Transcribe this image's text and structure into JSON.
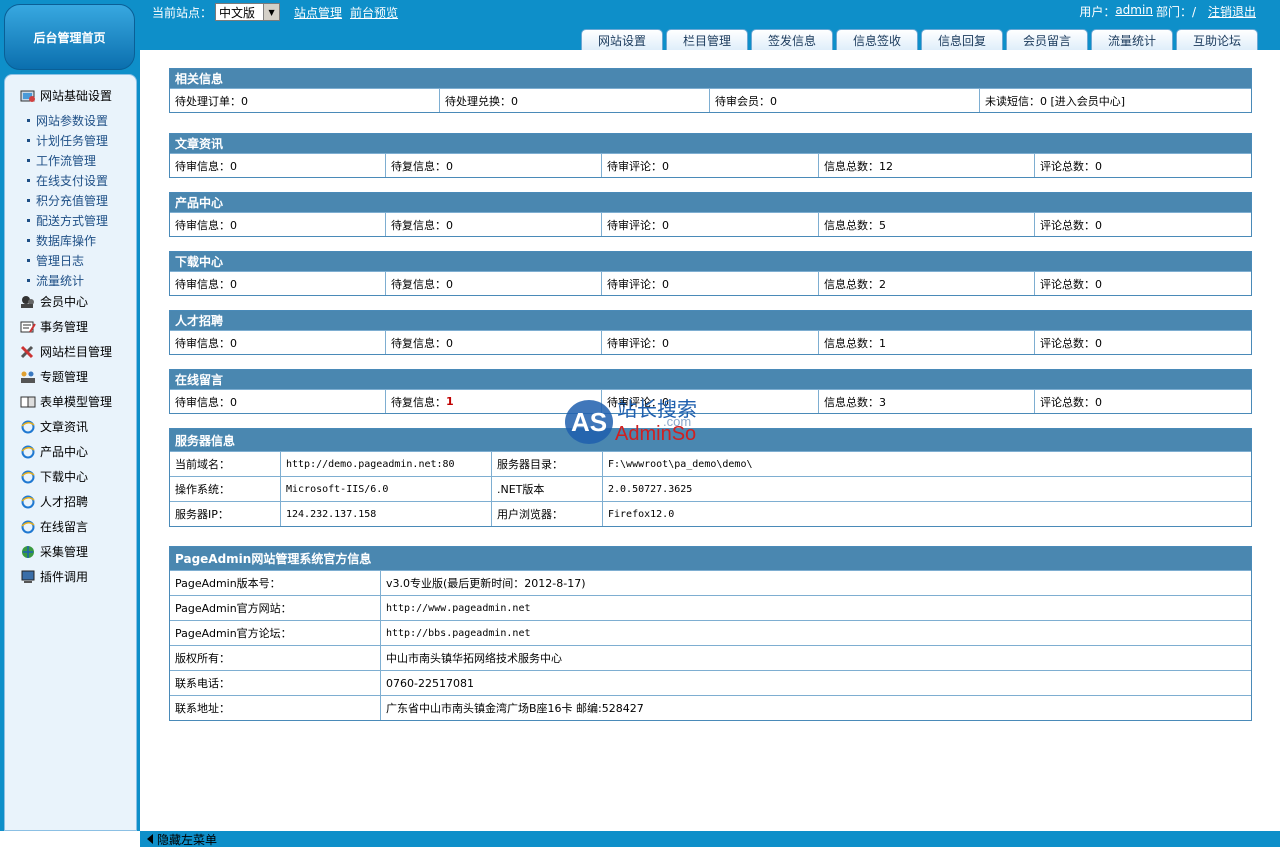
{
  "header": {
    "logo_text": "后台管理首页",
    "current_site_label": "当前站点：",
    "current_site_value": "中文版",
    "site_manage_link": "站点管理",
    "front_preview_link": "前台预览",
    "user_label": "用户：",
    "user_name": "admin",
    "dept_label": "部门：/",
    "logout_link": "注销退出"
  },
  "tabs": [
    "网站设置",
    "栏目管理",
    "签发信息",
    "信息签收",
    "信息回复",
    "会员留言",
    "流量统计",
    "互助论坛"
  ],
  "sidebar": {
    "basic_settings": "网站基础设置",
    "sub_items": [
      "网站参数设置",
      "计划任务管理",
      "工作流管理",
      "在线支付设置",
      "积分充值管理",
      "配送方式管理",
      "数据库操作",
      "管理日志",
      "流量统计"
    ],
    "groups": [
      {
        "label": "会员中心",
        "icon": "members-icon"
      },
      {
        "label": "事务管理",
        "icon": "tasks-icon"
      },
      {
        "label": "网站栏目管理",
        "icon": "tools-icon"
      },
      {
        "label": "专题管理",
        "icon": "topics-icon"
      },
      {
        "label": "表单模型管理",
        "icon": "form-model-icon"
      },
      {
        "label": "文章资讯",
        "icon": "ie-icon"
      },
      {
        "label": "产品中心",
        "icon": "ie-icon"
      },
      {
        "label": "下载中心",
        "icon": "ie-icon"
      },
      {
        "label": "人才招聘",
        "icon": "ie-icon"
      },
      {
        "label": "在线留言",
        "icon": "ie-icon"
      },
      {
        "label": "采集管理",
        "icon": "globe-icon"
      },
      {
        "label": "插件调用",
        "icon": "computer-icon"
      }
    ]
  },
  "related": {
    "title": "相关信息",
    "cells": [
      "待处理订单：0",
      "待处理兑换：0",
      "待审会员：0",
      "未读短信：0 [进入会员中心]"
    ]
  },
  "sections": [
    {
      "title": "文章资讯",
      "cells": [
        "待审信息：0",
        "待复信息：0",
        "待审评论：0",
        "信息总数：12",
        "评论总数：0"
      ]
    },
    {
      "title": "产品中心",
      "cells": [
        "待审信息：0",
        "待复信息：0",
        "待审评论：0",
        "信息总数：5",
        "评论总数：0"
      ]
    },
    {
      "title": "下载中心",
      "cells": [
        "待审信息：0",
        "待复信息：0",
        "待审评论：0",
        "信息总数：2",
        "评论总数：0"
      ]
    },
    {
      "title": "人才招聘",
      "cells": [
        "待审信息：0",
        "待复信息：0",
        "待审评论：0",
        "信息总数：1",
        "评论总数：0"
      ]
    },
    {
      "title": "在线留言",
      "cells": [
        "待审信息：0",
        "待复信息：",
        "待审评论：0",
        "信息总数：3",
        "评论总数：0"
      ],
      "pending_reply_count": "1"
    }
  ],
  "server": {
    "title": "服务器信息",
    "rows": [
      [
        "当前域名：",
        "http://demo.pageadmin.net:80",
        "服务器目录：",
        "F:\\wwwroot\\pa_demo\\demo\\"
      ],
      [
        "操作系统：",
        "Microsoft-IIS/6.0",
        ".NET版本",
        "2.0.50727.3625"
      ],
      [
        "服务器IP：",
        "124.232.137.158",
        "用户浏览器：",
        "Firefox12.0"
      ]
    ]
  },
  "official": {
    "title": "PageAdmin网站管理系统官方信息",
    "rows": [
      [
        "PageAdmin版本号：",
        "v3.0专业版(最后更新时间：2012-8-17)"
      ],
      [
        "PageAdmin官方网站：",
        "http://www.pageadmin.net"
      ],
      [
        "PageAdmin官方论坛：",
        "http://bbs.pageadmin.net"
      ],
      [
        "版权所有：",
        "中山市南头镇华拓网络技术服务中心"
      ],
      [
        "联系电话：",
        "0760-22517081"
      ],
      [
        "联系地址：",
        "广东省中山市南头镇金湾广场B座16卡 邮编:528427"
      ]
    ]
  },
  "footer": {
    "hide_menu": "隐藏左菜单"
  },
  "watermark": {
    "as": "AS",
    "cn": "站长搜索",
    "en": "AdminSo",
    "com": ".com"
  },
  "colors": {
    "brand": "#0e8fc9",
    "panel_head": "#4a87b0",
    "highlight": "#c00000"
  }
}
